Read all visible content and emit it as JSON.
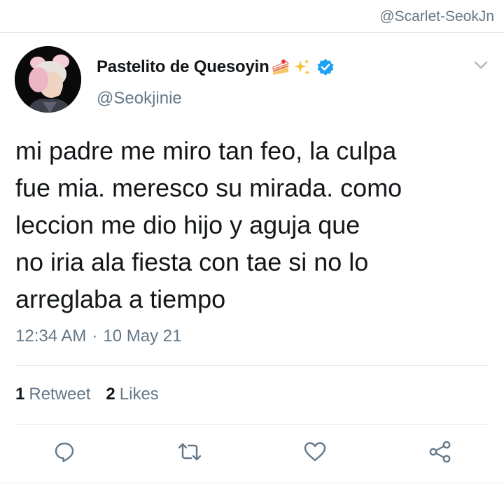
{
  "watermark": "@Scarlet-SeokJn",
  "author": {
    "display_name": "Pastelito de Quesoyin",
    "handle": "@Seokjinie",
    "emojis": [
      "cake-slice-icon",
      "sparkles-icon"
    ],
    "verified": true
  },
  "tweet": {
    "lines": [
      "mi padre me miro tan feo, la culpa",
      "fue mia. meresco su mirada. como",
      "leccion me dio hijo y aguja que",
      "no iria ala fiesta con tae si no lo",
      "arreglaba a tiempo"
    ],
    "time": "12:34 AM",
    "separator": "·",
    "date": "10 May 21"
  },
  "stats": {
    "retweets_count": "1",
    "retweets_label": "Retweet",
    "likes_count": "2",
    "likes_label": "Likes"
  },
  "actions": [
    "reply-icon",
    "retweet-icon",
    "like-icon",
    "share-icon"
  ],
  "colors": {
    "text": "#14171a",
    "secondary": "#657786",
    "divider": "#e1e8ed",
    "verified": "#1da1f2"
  }
}
